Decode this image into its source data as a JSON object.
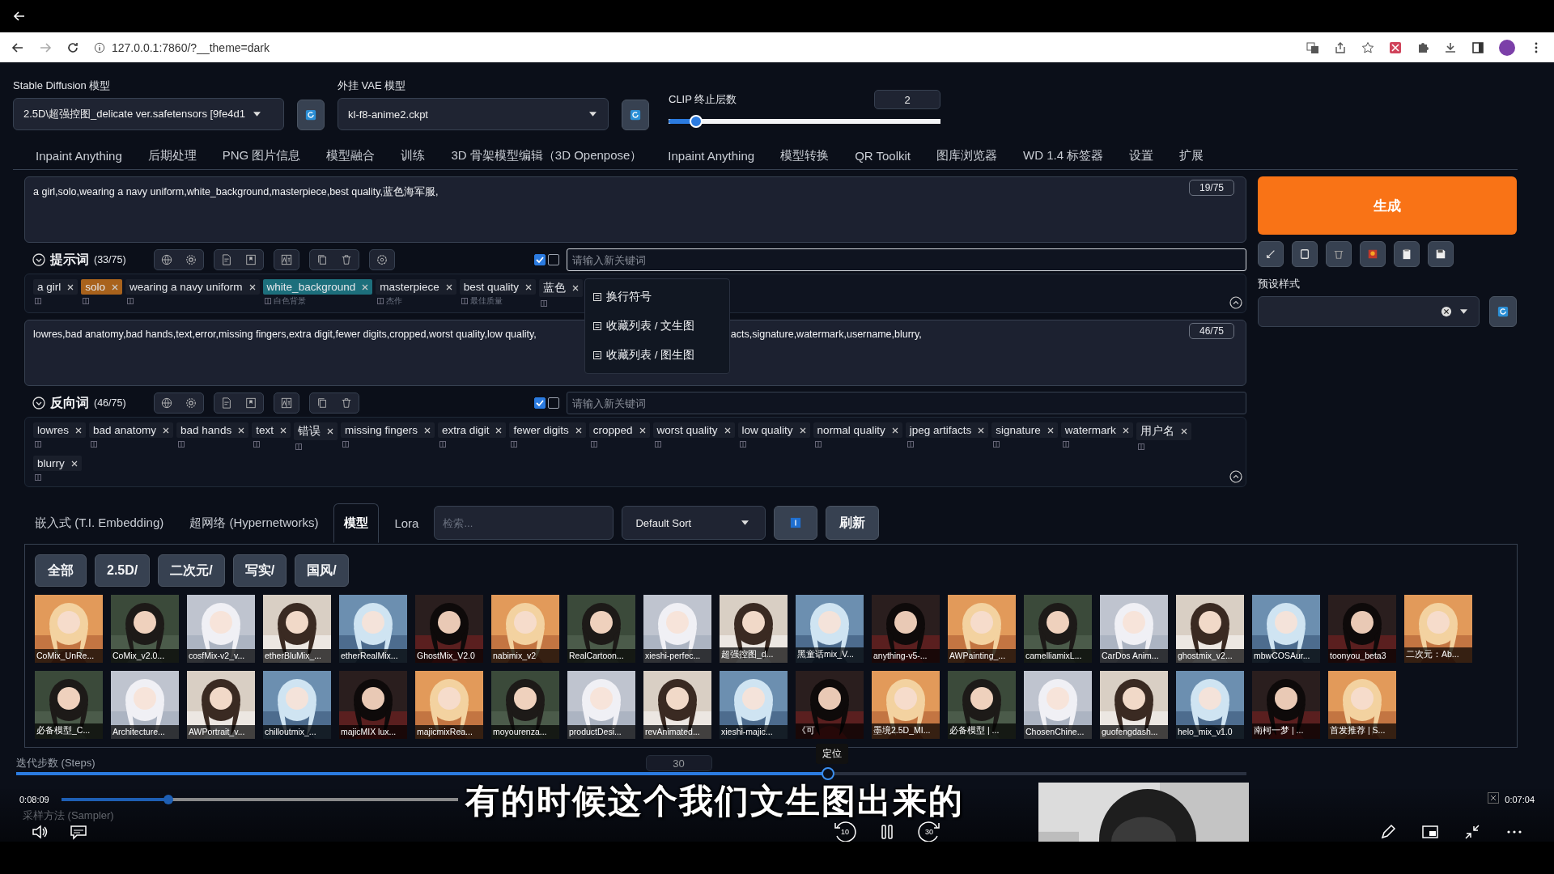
{
  "browser": {
    "url": "127.0.0.1:7860/?__theme=dark"
  },
  "model_selectors": [
    {
      "label": "Stable Diffusion 模型",
      "value": "2.5D\\超强控图_delicate ver.safetensors [9fe4d1"
    },
    {
      "label": "外挂 VAE 模型",
      "value": "kl-f8-anime2.ckpt"
    }
  ],
  "clip": {
    "label": "CLIP 终止层数",
    "value": "2",
    "level": 0.1
  },
  "tabs": [
    "Inpaint Anything",
    "后期处理",
    "PNG 图片信息",
    "模型融合",
    "训练",
    "3D 骨架模型编辑（3D Openpose）",
    "Inpaint Anything",
    "模型转换",
    "QR Toolkit",
    "图库浏览器",
    "WD 1.4 标签器",
    "设置",
    "扩展"
  ],
  "sections": [
    {
      "kind": "positive",
      "text_parts": [
        "a girl,solo,wearing a navy uniform,white_background,masterpiece,best quality,蓝色海军服,"
      ],
      "counter": "19/75",
      "title": "提示词",
      "count": "(33/75)",
      "checkboxes": [
        {
          "checked": true
        },
        {
          "checked": false
        }
      ],
      "placeholder": "请输入新关键词",
      "tags": [
        {
          "text": "a girl"
        },
        {
          "text": "solo",
          "color": "#a8621c"
        },
        {
          "text": "wearing a navy uniform"
        },
        {
          "text": "white_background",
          "color": "#1d6f7c",
          "note": "白色背景"
        },
        {
          "text": "masterpiece",
          "note": "杰作"
        },
        {
          "text": "best quality",
          "note": "最佳质量"
        },
        {
          "text": "蓝色"
        }
      ]
    },
    {
      "kind": "negative",
      "text_parts": [
        "lowres,bad anatomy,bad hands,text,error,missing fingers,extra digit,fewer digits,cropped,worst quality,low quality,",
        "acts,signature,watermark,username,blurry,"
      ],
      "counter": "46/75",
      "title": "反向词",
      "count": "(46/75)",
      "checkboxes": [
        {
          "checked": true
        },
        {
          "checked": false
        }
      ],
      "placeholder": "请输入新关键词",
      "tags": [
        {
          "text": "lowres"
        },
        {
          "text": "bad anatomy"
        },
        {
          "text": "bad hands"
        },
        {
          "text": "text"
        },
        {
          "text": "错误"
        },
        {
          "text": "missing fingers"
        },
        {
          "text": "extra digit"
        },
        {
          "text": "fewer digits"
        },
        {
          "text": "cropped"
        },
        {
          "text": "worst quality"
        },
        {
          "text": "low quality"
        },
        {
          "text": "normal quality"
        },
        {
          "text": "jpeg artifacts"
        },
        {
          "text": "signature"
        },
        {
          "text": "watermark"
        },
        {
          "text": "用户名"
        },
        {
          "text": "blurry"
        }
      ]
    }
  ],
  "menu": [
    "换行符号",
    "收藏列表 / 文生图",
    "收藏列表 / 图生图"
  ],
  "generate": "生成",
  "styles": {
    "label": "预设样式"
  },
  "extra_tabs": [
    {
      "label": "嵌入式 (T.I. Embedding)",
      "selected": false
    },
    {
      "label": "超网络 (Hypernetworks)",
      "selected": false
    },
    {
      "label": "模型",
      "selected": true
    },
    {
      "label": "Lora",
      "selected": false
    }
  ],
  "search": {
    "placeholder": "检索..."
  },
  "sort": "Default Sort",
  "refresh": "刷新",
  "folders": [
    "全部",
    "2.5D/",
    "二次元/",
    "写实/",
    "国风/"
  ],
  "cards": [
    "CoMix_UnRe...",
    "CoMix_v2.0...",
    "cosfMix-v2_v...",
    "etherBluMix_...",
    "etherRealMix...",
    "GhostMix_V2.0",
    "nabimix_v2",
    "RealCartoon...",
    "xieshi-perfec...",
    "超强控图_d...",
    "黑童话mix_V...",
    "anything-v5-...",
    "AWPainting_...",
    "camelliamixL...",
    "CarDos Anim...",
    "ghostmix_v2...",
    "mbwCOSAur...",
    "toonyou_beta3",
    "二次元：Ab...",
    "必备模型_C...",
    "Architecture...",
    "AWPortrait_v...",
    "chilloutmix_...",
    "majicMIX lux...",
    "majicmixRea...",
    "moyourenza...",
    "productDesi...",
    "revAnimated...",
    "xieshi-majic...",
    "《可",
    "墨境2.5D_MI...",
    "必备模型 | ...",
    "ChosenChine...",
    "guofengdash...",
    "helo_mix_v1.0",
    "南柯一梦 | ...",
    "首发推荐 | S..."
  ],
  "steps": {
    "label": "迭代步数 (Steps)",
    "value": "30",
    "level": 0.66
  },
  "sampler": {
    "label": "采样方法 (Sampler)"
  },
  "video": {
    "tooltip": "定位",
    "elapsed": "0:08:09",
    "remaining": "0:07:04",
    "level": 0.27,
    "subtitle": "有的时候这个我们文生图出来的",
    "skip_back": "10",
    "skip_forward": "30"
  }
}
